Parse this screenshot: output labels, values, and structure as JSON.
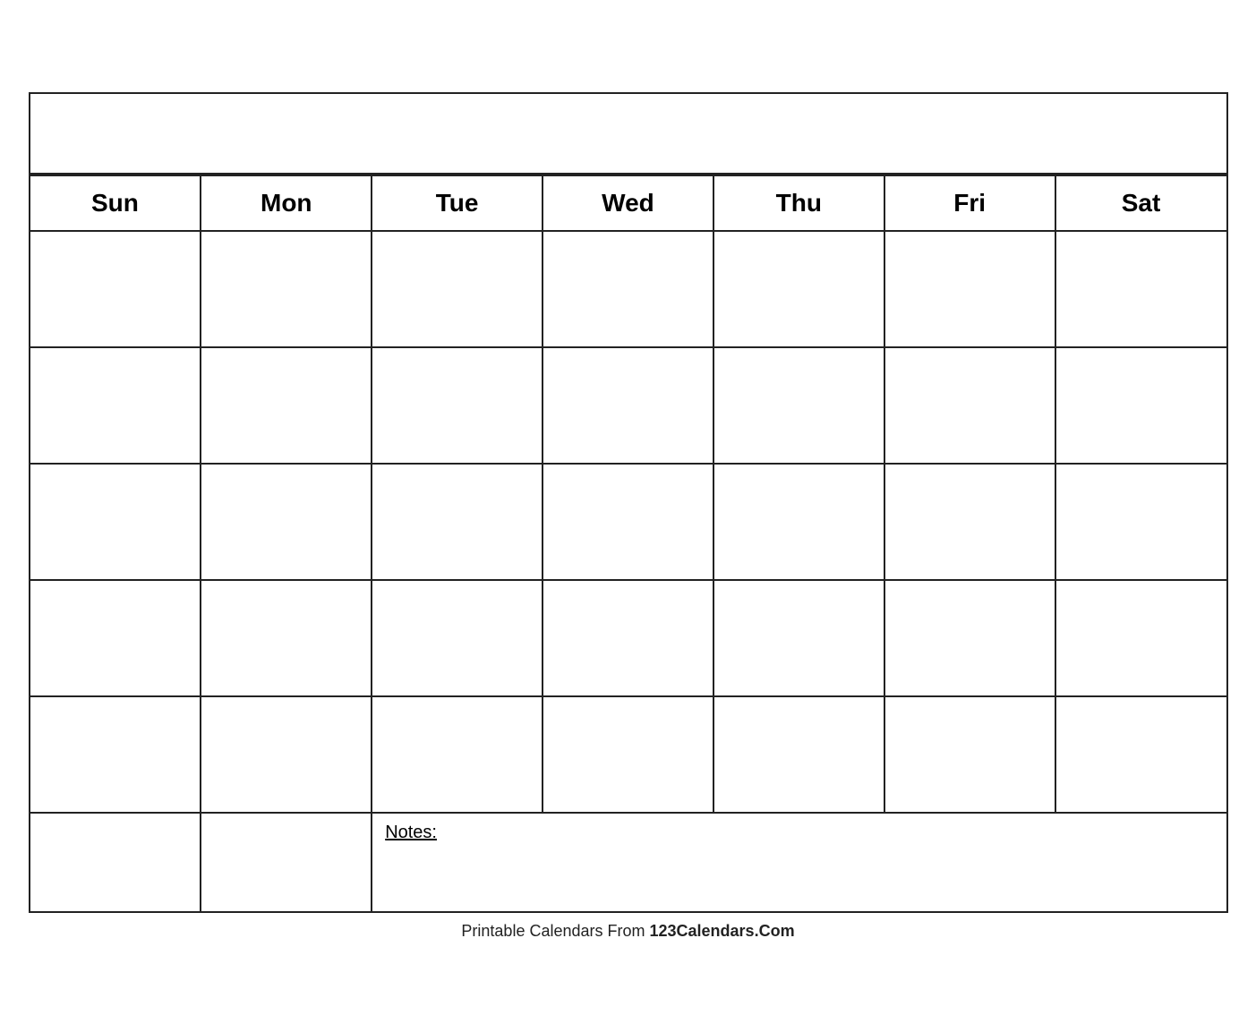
{
  "calendar": {
    "title": "",
    "days": [
      "Sun",
      "Mon",
      "Tue",
      "Wed",
      "Thu",
      "Fri",
      "Sat"
    ],
    "weeks": 5,
    "notes_label": "Notes:"
  },
  "footer": {
    "text_regular": "Printable Calendars From ",
    "text_bold": "123Calendars.Com"
  }
}
